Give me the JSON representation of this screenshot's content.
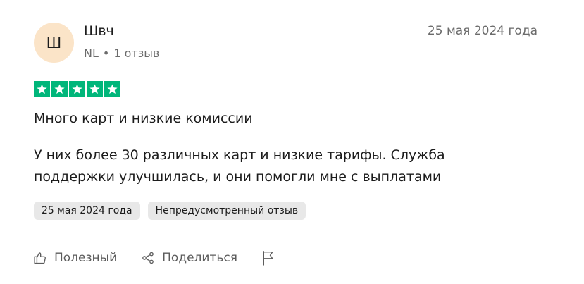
{
  "reviewer": {
    "initials": "Ш",
    "name": "Швч",
    "country": "NL",
    "separator": "•",
    "review_count": "1 отзыв",
    "avatar_color": "#fbe4c8"
  },
  "review": {
    "date": "25 мая 2024 года",
    "rating": 5,
    "star_color": "#00b67a",
    "title": "Много карт и низкие комиссии",
    "body": "У них более 30 различных карт и низкие тарифы. Служба поддержки улучшилась, и они помогли мне с выплатами"
  },
  "chips": {
    "experience_date": "25 мая 2024 года",
    "unsolicited": "Непредусмотренный отзыв"
  },
  "actions": {
    "useful_label": "Полезный",
    "share_label": "Поделиться",
    "useful_icon": "thumbs-up-icon",
    "share_icon": "share-icon",
    "flag_icon": "flag-icon"
  }
}
